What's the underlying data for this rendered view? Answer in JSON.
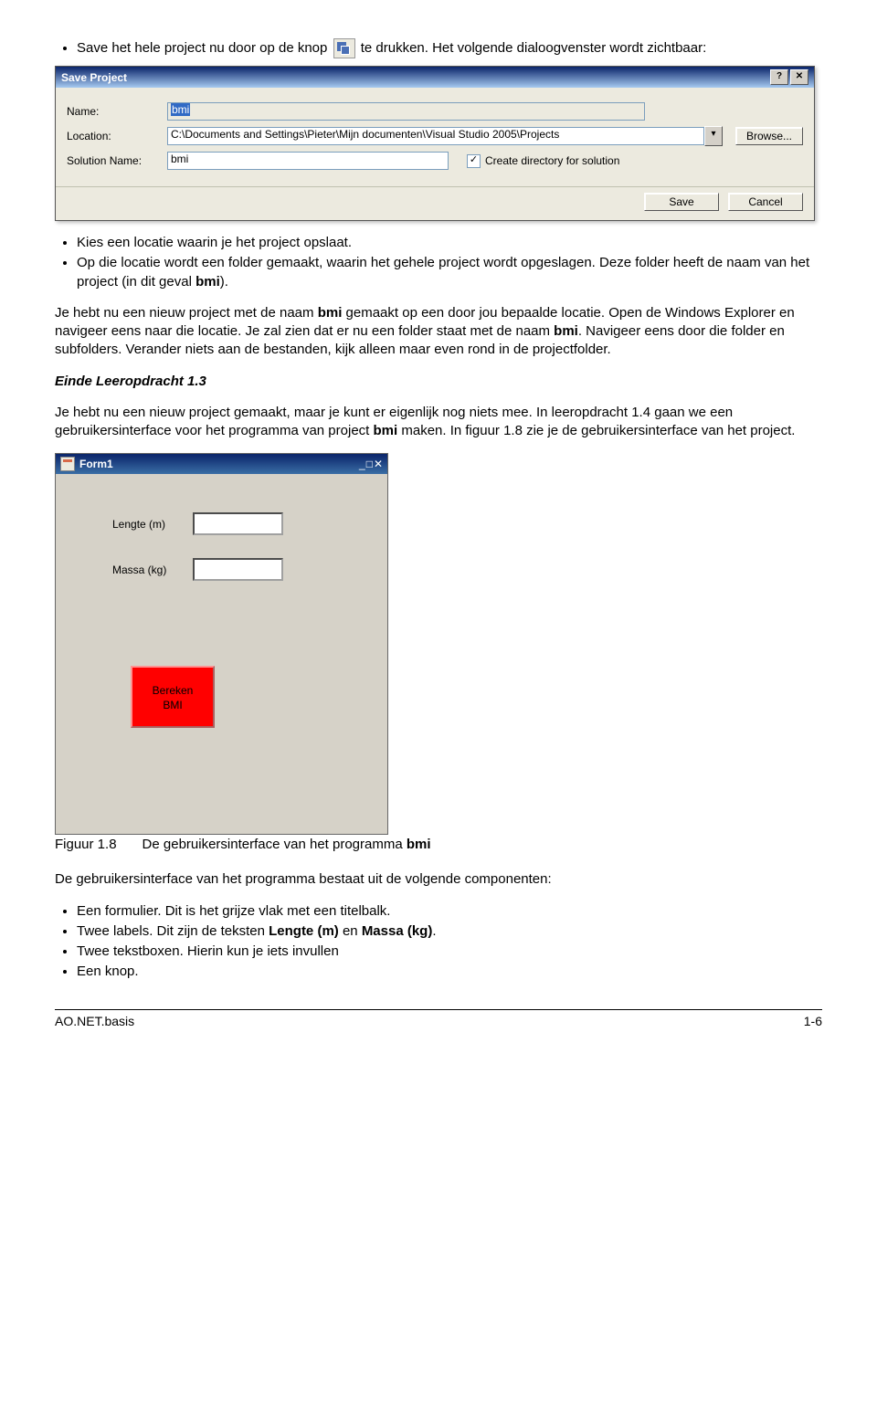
{
  "bullet1_before": "Save het hele project nu door op de knop",
  "bullet1_after": "te drukken. Het volgende dialoogvenster wordt zichtbaar:",
  "saveDialog": {
    "title": "Save Project",
    "nameLabel": "Name:",
    "nameValue": "bmi",
    "locationLabel": "Location:",
    "locationValue": "C:\\Documents and Settings\\Pieter\\Mijn documenten\\Visual Studio 2005\\Projects",
    "solutionLabel": "Solution Name:",
    "solutionValue": "bmi",
    "browse": "Browse...",
    "createDir": "Create directory for solution",
    "saveBtn": "Save",
    "cancelBtn": "Cancel",
    "helpGlyph": "?",
    "closeGlyph": "✕",
    "checkGlyph": "✓",
    "dropGlyph": "▾"
  },
  "bullet2_a": "Kies een locatie waarin je het project opslaat.",
  "bullet2_b_1": "Op die locatie wordt een folder gemaakt, waarin het gehele project wordt opgeslagen. Deze folder heeft de naam van het project (in dit geval ",
  "bullet2_b_bold": "bmi",
  "bullet2_b_2": ").",
  "para1_1": "Je hebt nu een nieuw project met de naam ",
  "para1_b1": "bmi",
  "para1_2": " gemaakt op een door jou bepaalde locatie. Open de Windows Explorer en navigeer eens naar die locatie. Je zal zien dat er nu een folder staat met de naam ",
  "para1_b2": "bmi",
  "para1_3": ". Navigeer eens door die folder en subfolders. Verander niets aan de bestanden, kijk alleen maar even rond in de projectfolder.",
  "einde": "Einde Leeropdracht 1.3",
  "para2_1": "Je hebt nu een nieuw project gemaakt, maar je kunt er eigenlijk nog niets mee. In leeropdracht 1.4 gaan we een gebruikersinterface voor het programma van project ",
  "para2_b": "bmi",
  "para2_2": " maken. In figuur 1.8 zie je de gebruikersinterface van het project.",
  "form1": {
    "title": "Form1",
    "lengte": "Lengte (m)",
    "massa": "Massa (kg)",
    "btn1": "Bereken",
    "btn2": "BMI",
    "min": "_",
    "max": "□",
    "close": "✕"
  },
  "captionNum": "Figuur 1.8",
  "captionText_1": "De gebruikersinterface van het programma ",
  "captionText_b": "bmi",
  "para3": "De gebruikersinterface van het programma bestaat uit de volgende componenten:",
  "comp1": "Een formulier. Dit is het grijze vlak met een titelbalk.",
  "comp2_1": "Twee labels. Dit zijn de teksten ",
  "comp2_b1": "Lengte (m)",
  "comp2_mid": " en ",
  "comp2_b2": "Massa (kg)",
  "comp2_2": ".",
  "comp3": "Twee tekstboxen. Hierin kun je iets invullen",
  "comp4": "Een knop.",
  "footerLeft": "AO.NET.basis",
  "footerRight": "1-6"
}
